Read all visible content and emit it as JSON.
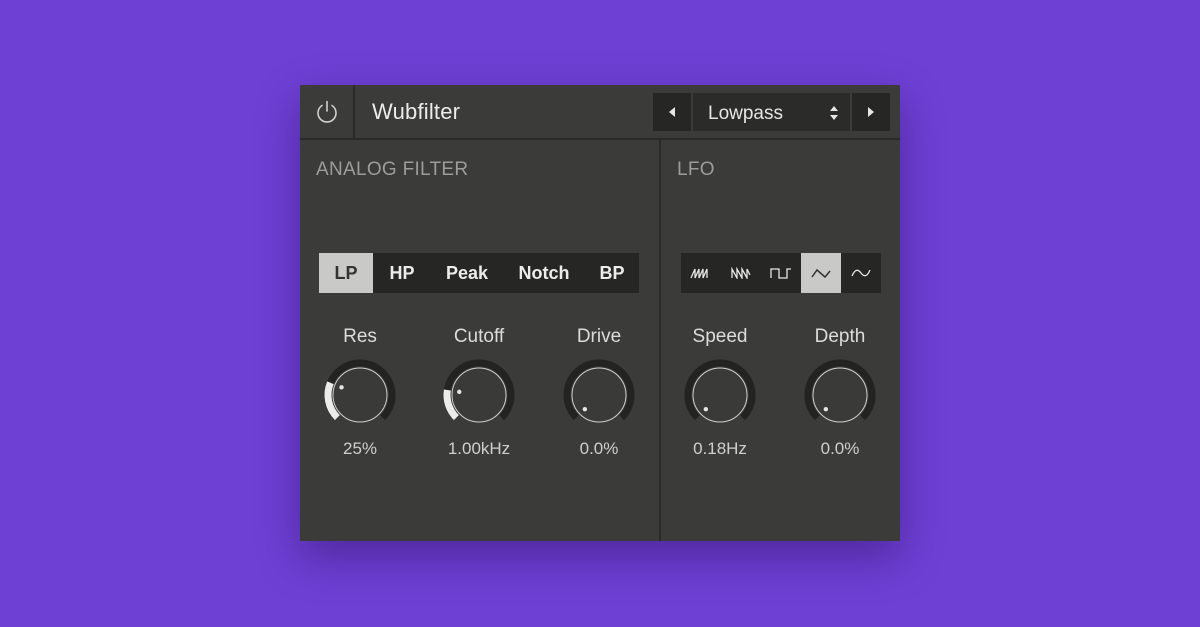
{
  "header": {
    "title": "Wubfilter",
    "power_icon": "power-icon",
    "preset": {
      "prev_icon": "triangle-left-icon",
      "next_icon": "triangle-right-icon",
      "value": "Lowpass",
      "select_icon": "up-down-arrows-icon"
    }
  },
  "analog_filter": {
    "title": "ANALOG FILTER",
    "types": [
      {
        "label": "LP",
        "active": true
      },
      {
        "label": "HP",
        "active": false
      },
      {
        "label": "Peak",
        "active": false
      },
      {
        "label": "Notch",
        "active": false
      },
      {
        "label": "BP",
        "active": false
      }
    ],
    "knobs": [
      {
        "label": "Res",
        "value": "25%",
        "level": 0.25
      },
      {
        "label": "Cutoff",
        "value": "1.00kHz",
        "level": 0.2
      },
      {
        "label": "Drive",
        "value": "0.0%",
        "level": 0.0
      }
    ]
  },
  "lfo": {
    "title": "LFO",
    "waveforms": [
      {
        "icon": "saw-up-wave-icon",
        "active": false
      },
      {
        "icon": "saw-down-wave-icon",
        "active": false
      },
      {
        "icon": "square-wave-icon",
        "active": false
      },
      {
        "icon": "triangle-wave-icon",
        "active": true
      },
      {
        "icon": "sine-wave-icon",
        "active": false
      }
    ],
    "knobs": [
      {
        "label": "Speed",
        "value": "0.18Hz",
        "level": 0.0
      },
      {
        "label": "Depth",
        "value": "0.0%",
        "level": 0.0
      }
    ]
  },
  "colors": {
    "background": "#6f40d4",
    "panel": "#3b3b39",
    "active_segment": "#c9c9c7",
    "knob_track": "#232322",
    "knob_fill": "#ececec"
  }
}
